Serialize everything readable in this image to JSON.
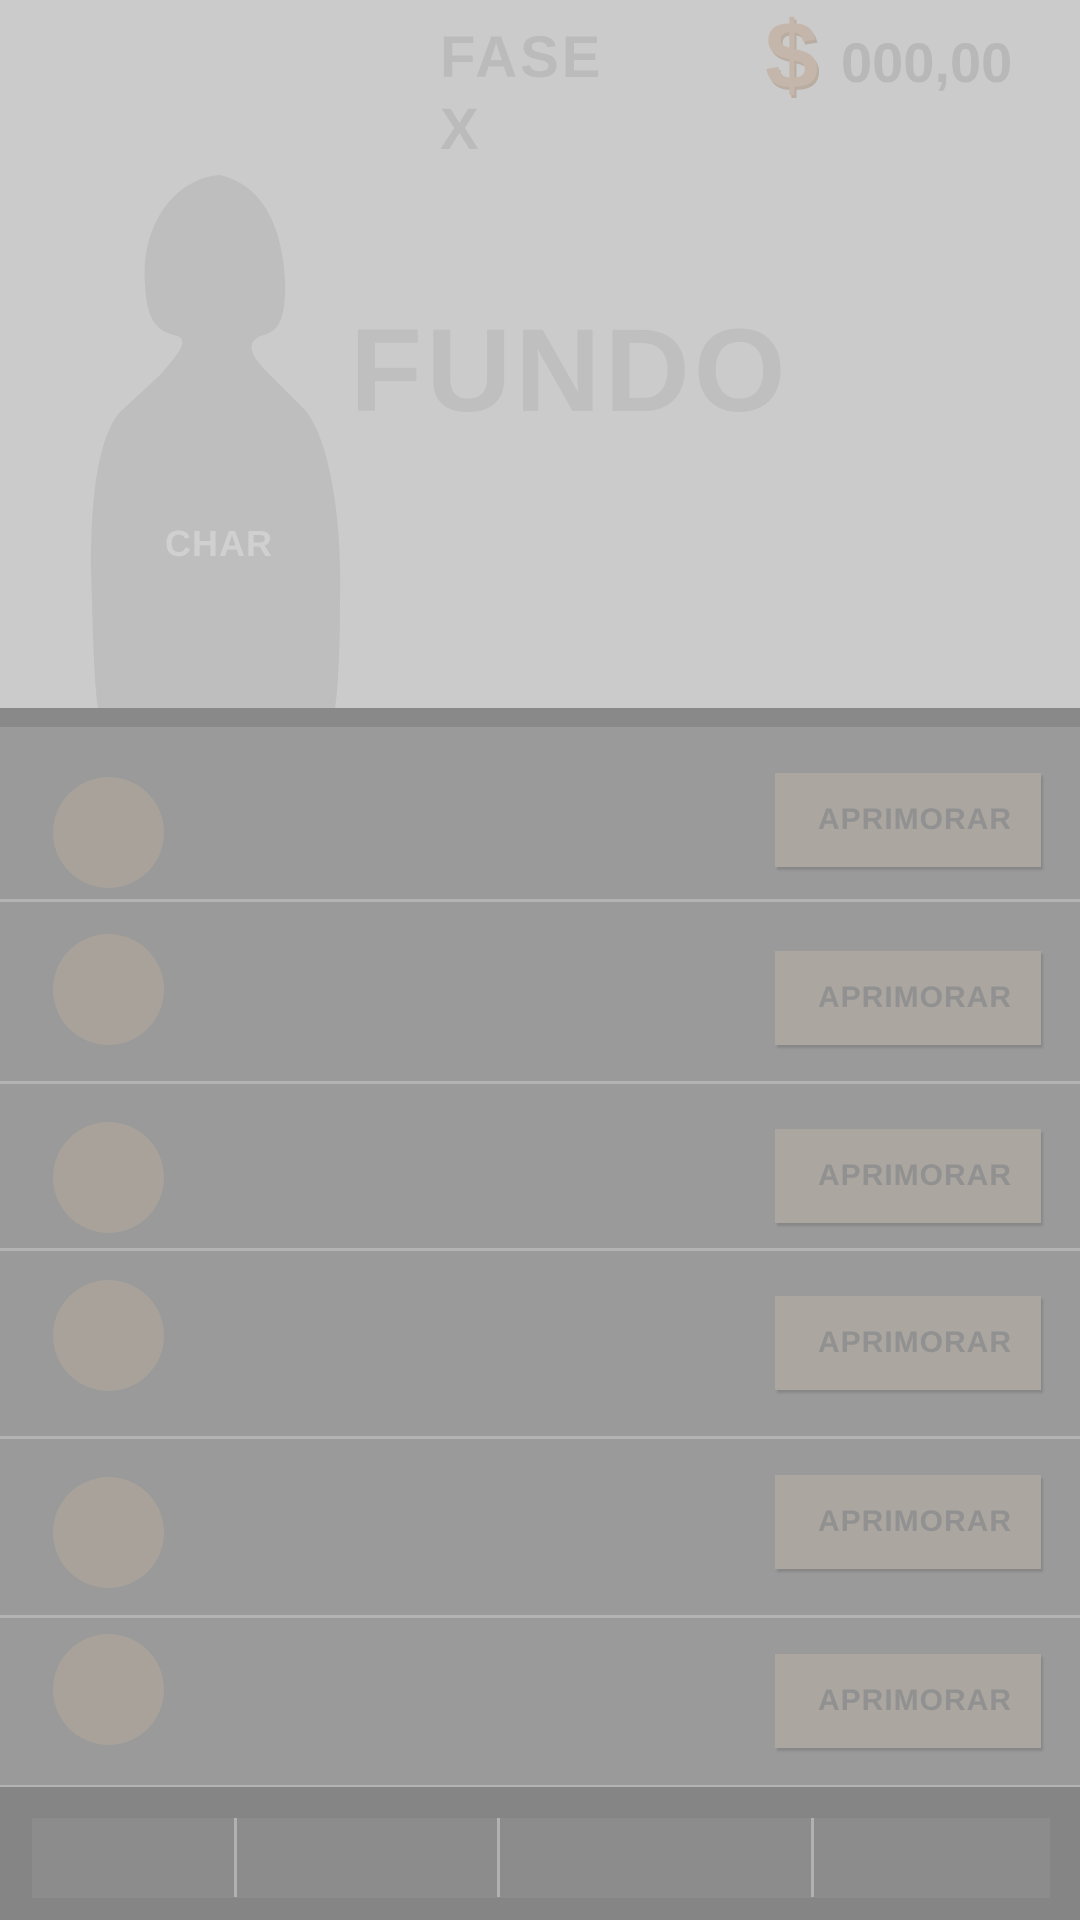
{
  "hud": {
    "phase": "FASE X",
    "currency_icon": "$",
    "money": "000,00"
  },
  "scene": {
    "background_label": "FUNDO",
    "character_label": "CHAR"
  },
  "upgrades": [
    {
      "button_label": "APRIMORAR"
    },
    {
      "button_label": "APRIMORAR"
    },
    {
      "button_label": "APRIMORAR"
    },
    {
      "button_label": "APRIMORAR"
    },
    {
      "button_label": "APRIMORAR"
    },
    {
      "button_label": "APRIMORAR"
    }
  ],
  "bottom_nav": {
    "tab_count": 4
  },
  "colors": {
    "scene_bg": "#cbcbcb",
    "panel_bg": "#9a9a9a",
    "item_icon": "#a8a29b",
    "button_bg": "#aba69f",
    "button_text": "#919191",
    "nav_bg": "#858585"
  }
}
